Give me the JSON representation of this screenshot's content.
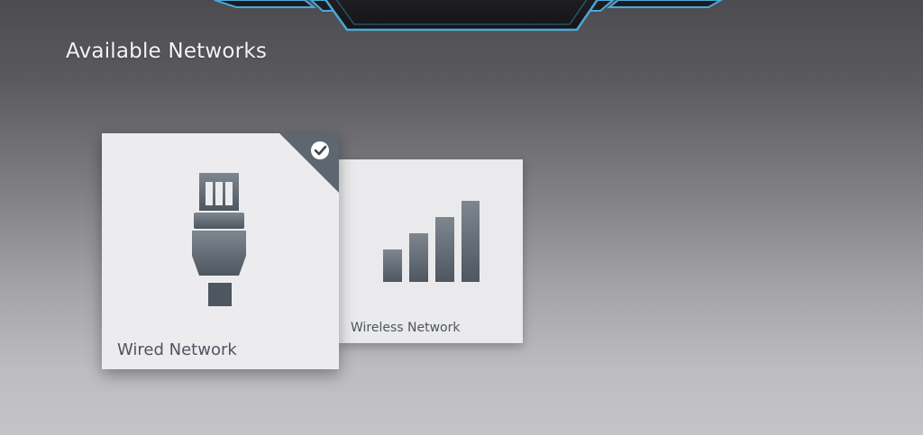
{
  "page": {
    "title": "Available Networks"
  },
  "networks": [
    {
      "label": "Wired Network",
      "icon": "ethernet-plug-icon",
      "selected": true
    },
    {
      "label": "Wireless Network",
      "icon": "signal-bars-icon",
      "selected": false
    }
  ],
  "colors": {
    "tile_background": "#ececee",
    "icon_fill": "#5e6670",
    "check_corner": "#5e6670",
    "frame_accent": "#4aa8d8",
    "frame_fill": "#1a1a1c",
    "title_text": "#f4f4f6",
    "label_text": "#4e5560"
  }
}
